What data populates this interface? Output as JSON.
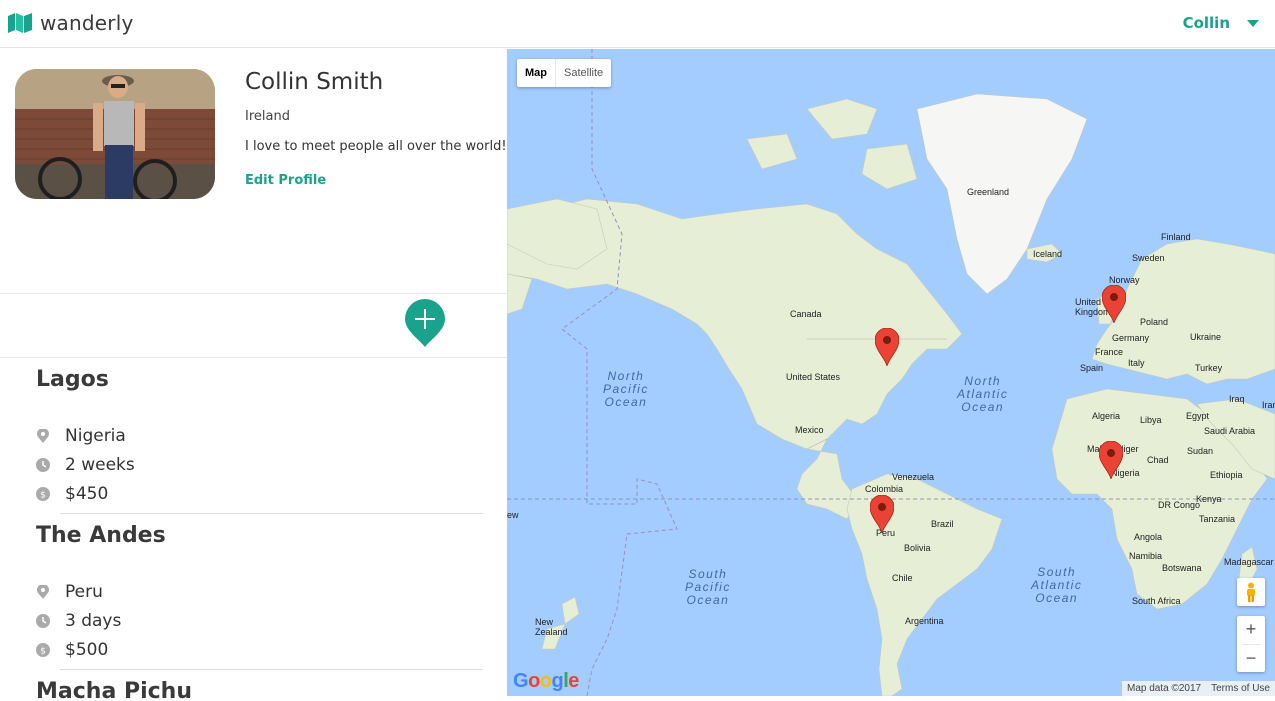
{
  "header": {
    "brand": "wanderly",
    "user_name": "Collin"
  },
  "profile": {
    "name": "Collin Smith",
    "country": "Ireland",
    "bio": "I love to meet people all over the world!",
    "edit_label": "Edit Profile"
  },
  "trips": [
    {
      "title": "Lagos",
      "country": "Nigeria",
      "duration": "2 weeks",
      "cost": "$450"
    },
    {
      "title": "The Andes",
      "country": "Peru",
      "duration": "3 days",
      "cost": "$500"
    },
    {
      "title": "Macha Pichu"
    }
  ],
  "map": {
    "type_map": "Map",
    "type_satellite": "Satellite",
    "labels": {
      "greenland": "Greenland",
      "iceland": "Iceland",
      "finland": "Finland",
      "sweden": "Sweden",
      "norway": "Norway",
      "uk": "United Kingdom",
      "poland": "Poland",
      "germany": "Germany",
      "ukraine": "Ukraine",
      "france": "France",
      "spain": "Spain",
      "italy": "Italy",
      "turkey": "Turkey",
      "iraq": "Iraq",
      "iran": "Iran",
      "algeria": "Algeria",
      "libya": "Libya",
      "egypt": "Egypt",
      "saudi": "Saudi Arabia",
      "mali": "Mali",
      "niger": "Niger",
      "chad": "Chad",
      "sudan": "Sudan",
      "ethiopia": "Ethiopia",
      "nigeria": "Nigeria",
      "kenya": "Kenya",
      "drc": "DR Congo",
      "tanzania": "Tanzania",
      "angola": "Angola",
      "namibia": "Namibia",
      "botswana": "Botswana",
      "madagascar": "Madagascar",
      "south_africa": "South Africa",
      "canada": "Canada",
      "us": "United States",
      "mexico": "Mexico",
      "venezuela": "Venezuela",
      "colombia": "Colombia",
      "peru": "Peru",
      "brazil": "Brazil",
      "bolivia": "Bolivia",
      "chile": "Chile",
      "argentina": "Argentina",
      "new_zealand": "New Zealand",
      "ew": "ew"
    },
    "oceans": {
      "north_pacific": [
        "North",
        "Pacific",
        "Ocean"
      ],
      "north_atlantic": [
        "North",
        "Atlantic",
        "Ocean"
      ],
      "south_pacific": [
        "South",
        "Pacific",
        "Ocean"
      ],
      "south_atlantic": [
        "South",
        "Atlantic",
        "Ocean"
      ]
    },
    "google": "Google",
    "map_data": "Map data ©2017",
    "terms": "Terms of Use",
    "zoom_in": "+",
    "zoom_out": "−",
    "colors": {
      "water": "#a3ccff",
      "land": "#e8f0d8",
      "accent": "#1aa38c",
      "marker": "#ea4335"
    }
  }
}
